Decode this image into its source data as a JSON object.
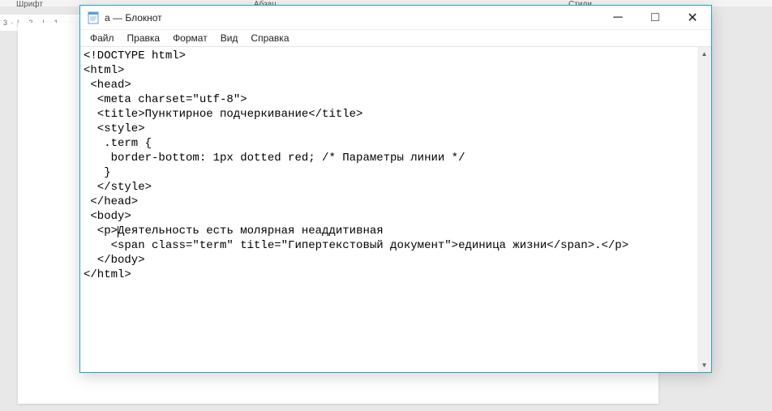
{
  "background": {
    "ribbon_left": "Шрифт",
    "ribbon_mid": "Абзац",
    "ribbon_right": "Стили",
    "ruler": "3 · | · 2 · | · 1"
  },
  "titlebar": {
    "title": "a — Блокнот"
  },
  "window_controls": {
    "minimize": "─",
    "maximize": "□",
    "close": "✕"
  },
  "menu": {
    "file": "Файл",
    "edit": "Правка",
    "format": "Формат",
    "view": "Вид",
    "help": "Справка"
  },
  "content": {
    "l0": "<!DOCTYPE html>",
    "l1": "<html>",
    "l2": " <head>",
    "l3": "  <meta charset=\"utf-8\">",
    "l4": "  <title>Пунктирное подчеркивание</title>",
    "l5": "  <style>",
    "l6": "   .term {",
    "l7": "    border-bottom: 1px dotted red; /* Параметры линии */",
    "l8": "   }",
    "l9": "  </style>",
    "l10": " </head>",
    "l11": " <body>",
    "l12a": "  <p>",
    "l12b": "Деятельность есть молярная неаддитивная",
    "l13": "    <span class=\"term\" title=\"Гипертекстовый документ\">единица жизни</span>.</p>",
    "l14": "  </body>",
    "l15": "</html>"
  },
  "scroll": {
    "up": "▲",
    "down": "▼"
  }
}
